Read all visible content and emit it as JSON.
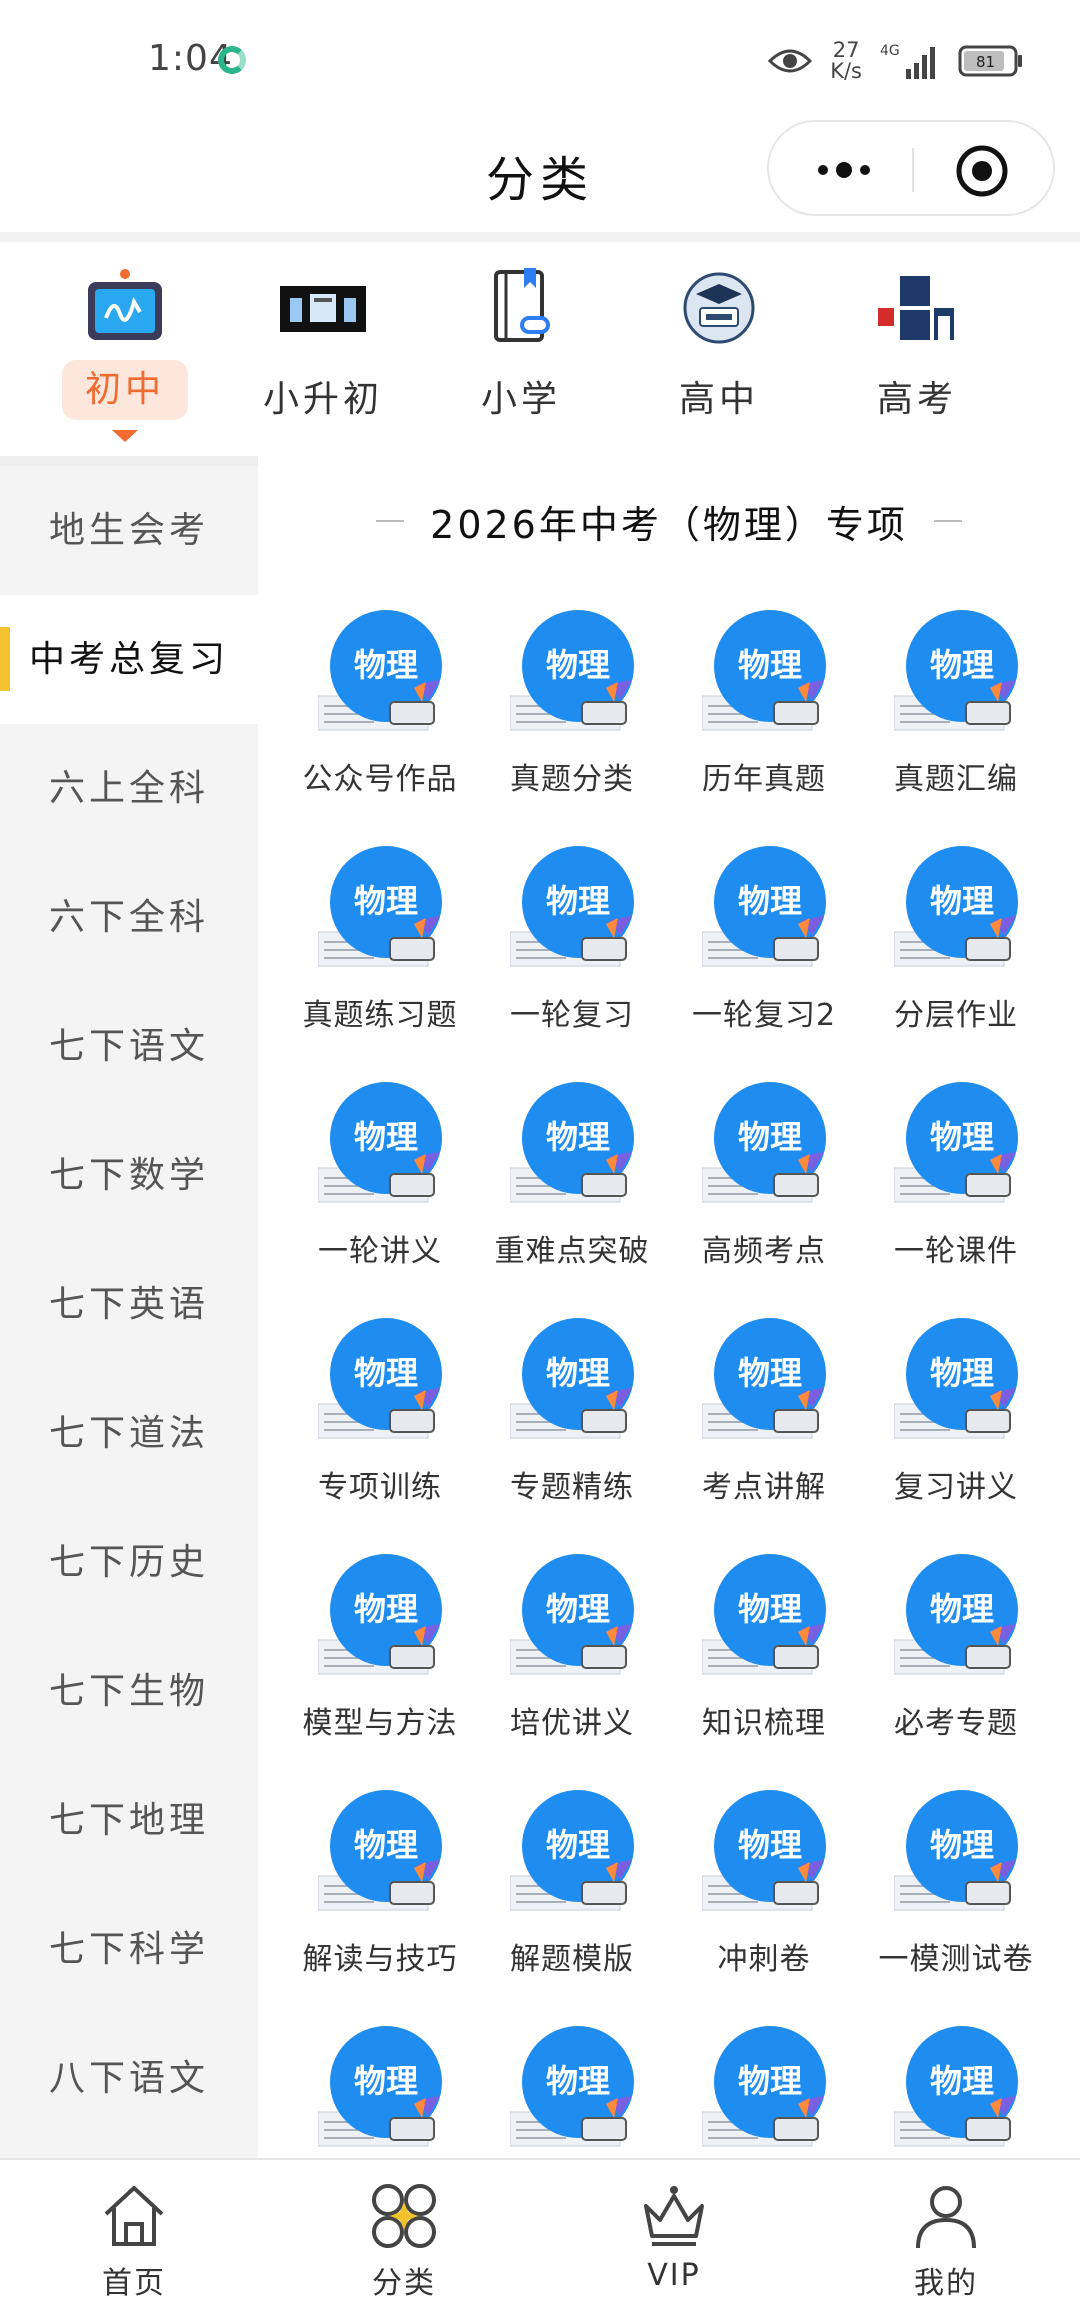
{
  "status_bar": {
    "time": "1:04",
    "net_speed_value": "27",
    "net_speed_unit": "K/s",
    "network": "4G",
    "battery": "81"
  },
  "header": {
    "title": "分类"
  },
  "category_nav": {
    "items": [
      {
        "label": "初中",
        "icon": "whiteboard-icon",
        "active": true
      },
      {
        "label": "小升初",
        "icon": "banner-thumbnail-icon",
        "active": false
      },
      {
        "label": "小学",
        "icon": "book-link-icon",
        "active": false
      },
      {
        "label": "高中",
        "icon": "graduation-cap-icon",
        "active": false
      },
      {
        "label": "高考",
        "icon": "gaokao-badge-icon",
        "active": false
      }
    ]
  },
  "sidebar": {
    "items": [
      {
        "label": "地生会考",
        "active": false
      },
      {
        "label": "中考总复习",
        "active": true
      },
      {
        "label": "六上全科",
        "active": false
      },
      {
        "label": "六下全科",
        "active": false
      },
      {
        "label": "七下语文",
        "active": false
      },
      {
        "label": "七下数学",
        "active": false
      },
      {
        "label": "七下英语",
        "active": false
      },
      {
        "label": "七下道法",
        "active": false
      },
      {
        "label": "七下历史",
        "active": false
      },
      {
        "label": "七下生物",
        "active": false
      },
      {
        "label": "七下地理",
        "active": false
      },
      {
        "label": "七下科学",
        "active": false
      },
      {
        "label": "八下语文",
        "active": false
      }
    ]
  },
  "content": {
    "section_title": "2026年中考（物理）专项",
    "icon_text": "物理",
    "items": [
      "公众号作品",
      "真题分类",
      "历年真题",
      "真题汇编",
      "真题练习题",
      "一轮复习",
      "一轮复习2",
      "分层作业",
      "一轮讲义",
      "重难点突破",
      "高频考点",
      "一轮课件",
      "专项训练",
      "专题精练",
      "考点讲解",
      "复习讲义",
      "模型与方法",
      "培优讲义",
      "知识梳理",
      "必考专题",
      "解读与技巧",
      "解题模版",
      "冲刺卷",
      "一模测试卷",
      "",
      "",
      "",
      ""
    ]
  },
  "tab_bar": {
    "tabs": [
      {
        "label": "首页",
        "icon": "home-icon",
        "active": false
      },
      {
        "label": "分类",
        "icon": "category-icon",
        "active": true
      },
      {
        "label": "VIP",
        "icon": "crown-icon",
        "active": false
      },
      {
        "label": "我的",
        "icon": "user-icon",
        "active": false
      }
    ]
  },
  "colors": {
    "accent_orange": "#ef6b2f",
    "accent_yellow": "#f2c12e",
    "icon_blue": "#1f8cf0"
  }
}
